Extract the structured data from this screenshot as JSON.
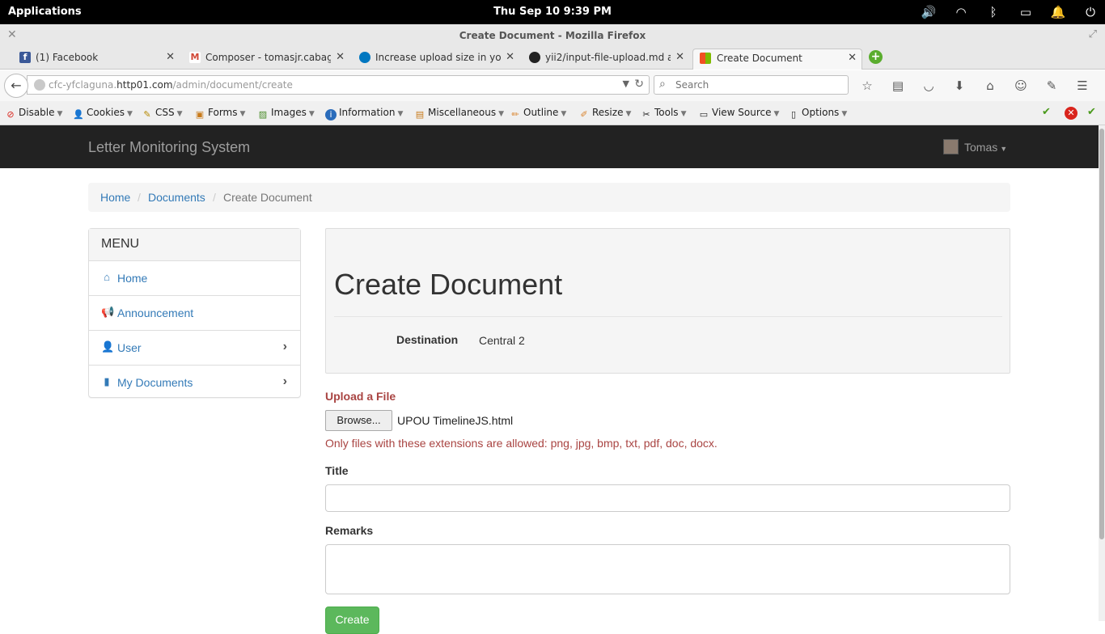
{
  "system_bar": {
    "applications": "Applications",
    "clock": "Thu Sep 10    9:39 PM",
    "tray": [
      "volume-icon",
      "wifi-icon",
      "bluetooth-icon",
      "battery-icon",
      "notification-icon",
      "power-icon"
    ]
  },
  "window": {
    "title": "Create Document - Mozilla Firefox"
  },
  "tabs": [
    {
      "label": "(1) Facebook",
      "icon": "facebook-icon",
      "color": "#3b5998",
      "glyph": "f"
    },
    {
      "label": "Composer - tomasjr.cabag...",
      "icon": "gmail-icon",
      "color": "#d14836",
      "glyph": "M"
    },
    {
      "label": "Increase upload size in yo...",
      "icon": "drupal-icon",
      "color": "#0077c0",
      "glyph": "◆"
    },
    {
      "label": "yii2/input-file-upload.md a...",
      "icon": "github-icon",
      "color": "#222222",
      "glyph": "●"
    },
    {
      "label": "Create Document",
      "icon": "windows-logo-icon",
      "color": "#f25022",
      "glyph": "■"
    }
  ],
  "navbar": {
    "url_prefix": "cfc-yfclaguna.",
    "url_host": "http01.com",
    "url_path": "/admin/document/create",
    "search_placeholder": "Search"
  },
  "devtoolbar": {
    "items": [
      "Disable",
      "Cookies",
      "CSS",
      "Forms",
      "Images",
      "Information",
      "Miscellaneous",
      "Outline",
      "Resize",
      "Tools",
      "View Source",
      "Options"
    ]
  },
  "site": {
    "brand": "Letter Monitoring System",
    "user": "Tomas"
  },
  "breadcrumb": {
    "home": "Home",
    "documents": "Documents",
    "current": "Create Document",
    "separator": "/"
  },
  "menu": {
    "heading": "MENU",
    "items": [
      {
        "label": "Home",
        "icon": "home-icon"
      },
      {
        "label": "Announcement",
        "icon": "bullhorn-icon"
      },
      {
        "label": "User",
        "icon": "user-icon"
      },
      {
        "label": "My Documents",
        "icon": "file-icon"
      }
    ]
  },
  "main": {
    "heading": "Create Document",
    "destination_label": "Destination",
    "destination_value": "Central 2",
    "upload_label": "Upload a File",
    "browse_label": "Browse...",
    "selected_file": "UPOU TimelineJS.html",
    "upload_error": "Only files with these extensions are allowed: png, jpg, bmp, txt, pdf, doc, docx.",
    "title_label": "Title",
    "title_value": "",
    "remarks_label": "Remarks",
    "remarks_value": "",
    "create_label": "Create"
  },
  "colors": {
    "brand_bar": "#222222",
    "link": "#337ab7",
    "error": "#a94442",
    "success": "#5cb85c"
  }
}
